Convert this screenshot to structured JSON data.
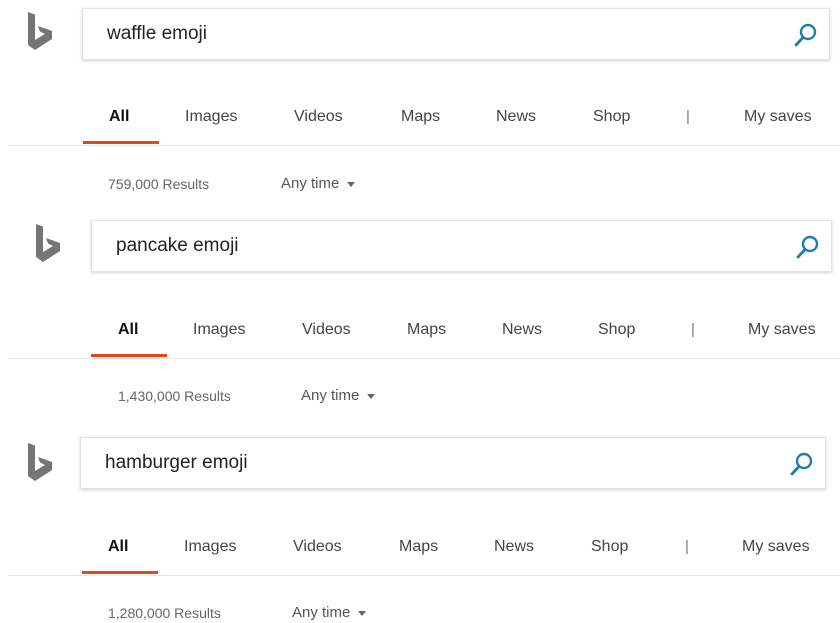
{
  "brand_color": "#de4a1c",
  "logo_color": "#757575",
  "search_icon_color": "#1d7ea8",
  "panels": [
    {
      "query": "waffle emoji",
      "tabs": [
        "All",
        "Images",
        "Videos",
        "Maps",
        "News",
        "Shop"
      ],
      "separator": "|",
      "my_saves": "My saves",
      "results": "759,000 Results",
      "time_filter": "Any time"
    },
    {
      "query": "pancake emoji",
      "tabs": [
        "All",
        "Images",
        "Videos",
        "Maps",
        "News",
        "Shop"
      ],
      "separator": "|",
      "my_saves": "My saves",
      "results": "1,430,000 Results",
      "time_filter": "Any time"
    },
    {
      "query": "hamburger emoji",
      "tabs": [
        "All",
        "Images",
        "Videos",
        "Maps",
        "News",
        "Shop"
      ],
      "separator": "|",
      "my_saves": "My saves",
      "results": "1,280,000 Results",
      "time_filter": "Any time"
    }
  ]
}
